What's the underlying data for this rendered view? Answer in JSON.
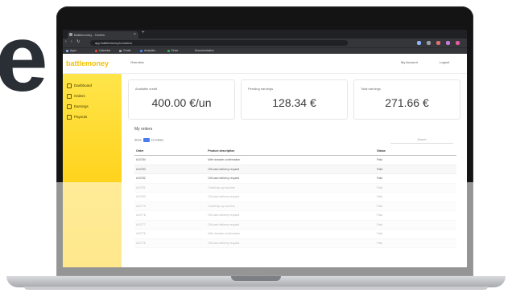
{
  "hero_text": "e",
  "browser": {
    "tab_title": "Battlemoney - Orders",
    "url": "app.battlemoney.io/orders",
    "bookmarks": [
      "Apps",
      "Calendar",
      "Gmail",
      "Analytics",
      "Drive",
      "Documentation"
    ]
  },
  "app": {
    "brand": "battlemoney",
    "top_nav": "Overview",
    "user": "My Account",
    "logout": "Logout",
    "sidebar": [
      "Dashboard",
      "Orders",
      "Earnings",
      "Payouts"
    ],
    "cards": [
      {
        "title": "Available credit",
        "value": "400.00 €/un"
      },
      {
        "title": "Pending earnings",
        "value": "128.34 €"
      },
      {
        "title": "Total earnings",
        "value": "271.66 €"
      }
    ],
    "section_title": "My orders",
    "show_label": "Show",
    "show_value": "10",
    "entries_label": "entries",
    "search_label": "Search",
    "columns": [
      "Order",
      "Product description",
      "Status"
    ],
    "rows": [
      [
        "#10784",
        "Wire transfer confirmation",
        "Paid"
      ],
      [
        "#10783",
        "Gift card delivery request",
        "Paid"
      ],
      [
        "#10782",
        "Gift card delivery request",
        "Paid"
      ],
      [
        "#10781",
        "Credit top-up voucher",
        "Paid"
      ],
      [
        "#10780",
        "Gift card delivery request",
        "Paid"
      ],
      [
        "#10779",
        "Credit top-up voucher",
        "Paid"
      ],
      [
        "#10778",
        "Gift card delivery request",
        "Paid"
      ],
      [
        "#10777",
        "Gift card delivery request",
        "Paid"
      ],
      [
        "#10776",
        "Wire transfer confirmation",
        "Paid"
      ],
      [
        "#10775",
        "Gift card delivery request",
        "Paid"
      ]
    ]
  },
  "laptop_model": "MacBook Pro",
  "colors": {
    "brand": "#f2c200",
    "sidebar": "#ffd21a",
    "accent": "#4a7cf0",
    "bezel": "#141414"
  }
}
